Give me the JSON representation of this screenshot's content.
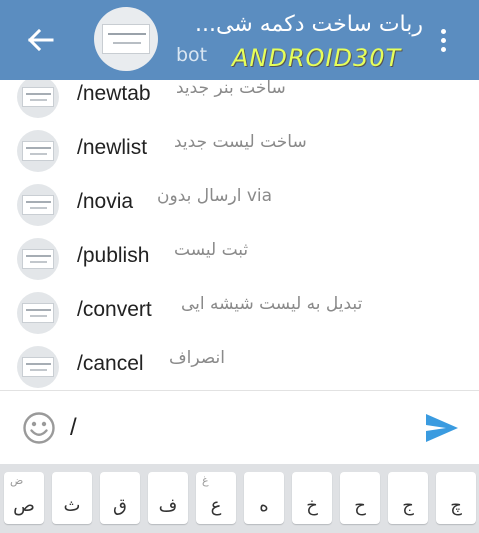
{
  "header": {
    "title": "ربات ساخت دکمه شی...",
    "subtitle": "bot",
    "watermark": "ANDROID30T",
    "back_icon": "arrow-left-icon",
    "menu_icon": "more-vertical-icon",
    "background": "#5b8dc0"
  },
  "commands": [
    {
      "name": "/newtab",
      "description": "ساخت بنر جدید"
    },
    {
      "name": "/newlist",
      "description": "ساخت لیست جدید"
    },
    {
      "name": "/novia",
      "description": "ارسال بدون via"
    },
    {
      "name": "/publish",
      "description": "ثبت لیست"
    },
    {
      "name": "/convert",
      "description": "تبدیل به لیست شیشه ایی"
    },
    {
      "name": "/cancel",
      "description": "انصراف"
    }
  ],
  "input": {
    "value": "/",
    "emoji_icon": "smiley-icon",
    "send_icon": "send-icon",
    "send_color": "#3a9be0"
  },
  "keyboard": {
    "keys": [
      {
        "main": "ص",
        "hint": "ض"
      },
      {
        "main": "ث",
        "hint": ""
      },
      {
        "main": "ق",
        "hint": ""
      },
      {
        "main": "ف",
        "hint": ""
      },
      {
        "main": "ع",
        "hint": "غ"
      },
      {
        "main": "ه",
        "hint": ""
      },
      {
        "main": "خ",
        "hint": ""
      },
      {
        "main": "ح",
        "hint": ""
      },
      {
        "main": "ج",
        "hint": ""
      },
      {
        "main": "چ",
        "hint": ""
      }
    ]
  }
}
